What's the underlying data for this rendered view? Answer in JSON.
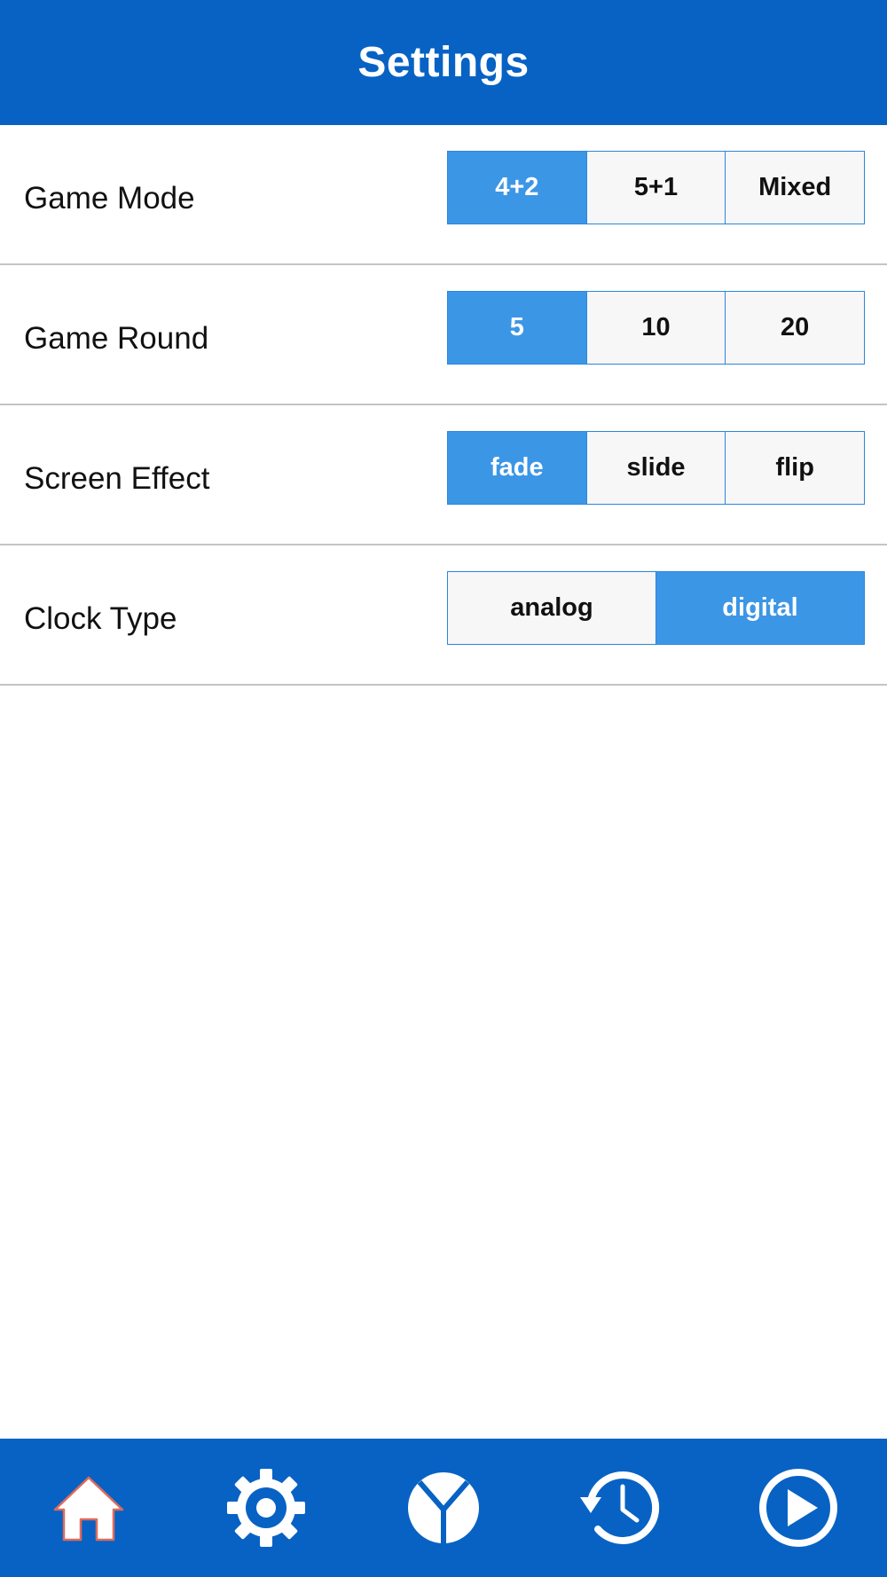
{
  "header": {
    "title": "Settings"
  },
  "settings": [
    {
      "label": "Game Mode",
      "options": [
        "4+2",
        "5+1",
        "Mixed"
      ],
      "selected": 0
    },
    {
      "label": "Game Round",
      "options": [
        "5",
        "10",
        "20"
      ],
      "selected": 0
    },
    {
      "label": "Screen Effect",
      "options": [
        "fade",
        "slide",
        "flip"
      ],
      "selected": 0
    },
    {
      "label": "Clock Type",
      "options": [
        "analog",
        "digital"
      ],
      "selected": 1
    }
  ],
  "tabbar": {
    "items": [
      {
        "icon": "home-icon"
      },
      {
        "icon": "gear-icon"
      },
      {
        "icon": "mode-icon"
      },
      {
        "icon": "history-icon"
      },
      {
        "icon": "play-icon"
      }
    ]
  },
  "colors": {
    "primary": "#0762c4",
    "selected": "#3c96e6",
    "segment_border": "#2b86de",
    "unselected_bg": "#f7f7f7",
    "divider": "#c4c4c4"
  }
}
